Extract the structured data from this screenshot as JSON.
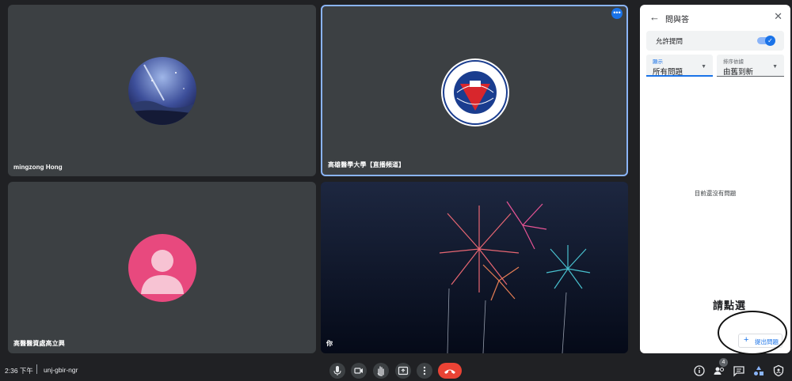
{
  "tiles": [
    {
      "name": "mingzong Hong"
    },
    {
      "name": "高雄醫學大學【直播頻道】"
    },
    {
      "name": "高醫醫資處高立興"
    },
    {
      "name": "你"
    }
  ],
  "panel": {
    "title": "問與答",
    "allow_label": "允許提問",
    "show_label": "顯示",
    "show_value": "所有問題",
    "sort_label": "排序依據",
    "sort_value": "由舊到新",
    "empty_message": "目前還沒有問題",
    "hint_text": "請點選",
    "ask_button": "提出問題"
  },
  "bottom": {
    "time": "2:36 下午",
    "meeting_code": "unj-gbir-ngr",
    "participant_count": "4"
  },
  "colors": {
    "accent": "#1a73e8",
    "leave": "#ea4335",
    "tile": "#3c4043",
    "background": "#202124"
  },
  "icons": [
    "mic-icon",
    "camera-icon",
    "hand-icon",
    "present-icon",
    "more-icon",
    "end-call-icon",
    "info-icon",
    "people-icon",
    "chat-icon",
    "activities-icon",
    "host-controls-icon"
  ]
}
